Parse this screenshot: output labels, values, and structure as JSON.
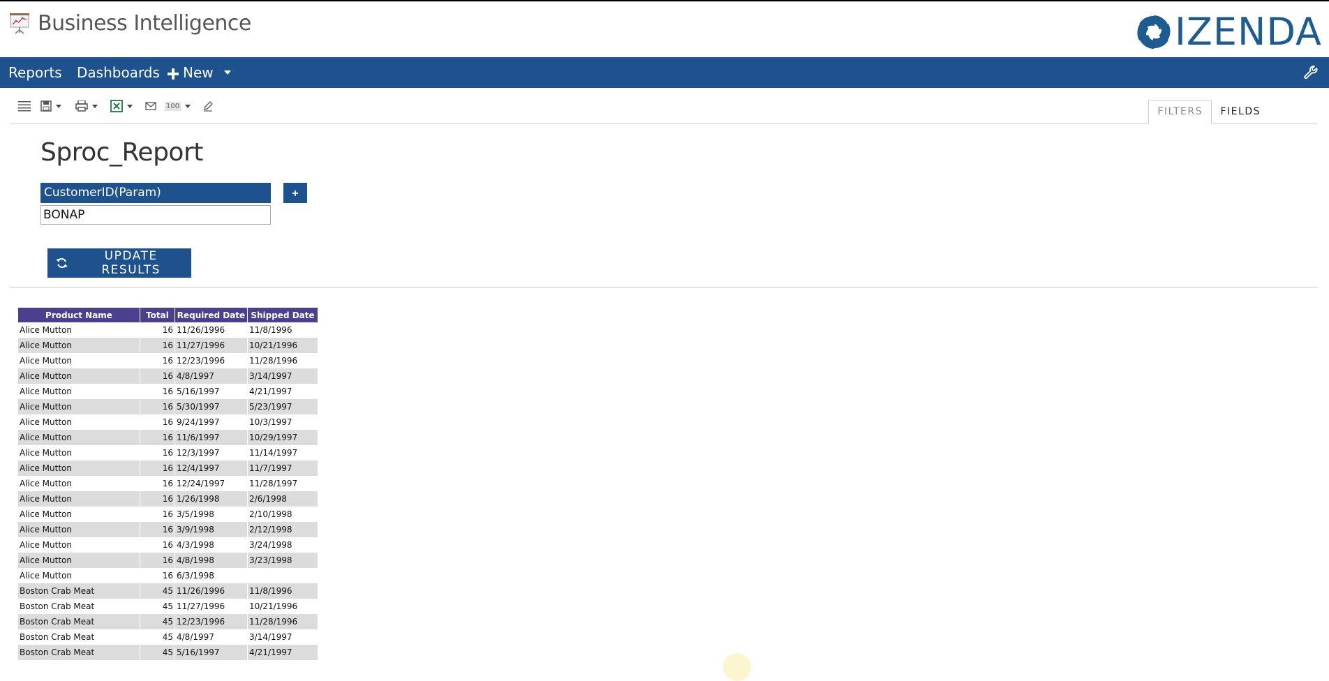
{
  "app": {
    "title": "Business Intelligence",
    "brand": "IZENDA"
  },
  "nav": {
    "reports": "Reports",
    "dashboards": "Dashboards",
    "new": "New"
  },
  "toolbar": {
    "zoom_value": "100"
  },
  "tabs": {
    "filters": "FILTERS",
    "fields": "FIELDS"
  },
  "report": {
    "title": "Sproc_Report"
  },
  "filter": {
    "label": "CustomerID(Param)",
    "value": "BONAP",
    "add_label": "+"
  },
  "update_button": {
    "label": "UPDATE RESULTS"
  },
  "table": {
    "columns": [
      "Product Name",
      "Total",
      "Required Date",
      "Shipped Date"
    ],
    "rows": [
      [
        "Alice Mutton",
        "16",
        "11/26/1996",
        "11/8/1996"
      ],
      [
        "Alice Mutton",
        "16",
        "11/27/1996",
        "10/21/1996"
      ],
      [
        "Alice Mutton",
        "16",
        "12/23/1996",
        "11/28/1996"
      ],
      [
        "Alice Mutton",
        "16",
        "4/8/1997",
        "3/14/1997"
      ],
      [
        "Alice Mutton",
        "16",
        "5/16/1997",
        "4/21/1997"
      ],
      [
        "Alice Mutton",
        "16",
        "5/30/1997",
        "5/23/1997"
      ],
      [
        "Alice Mutton",
        "16",
        "9/24/1997",
        "10/3/1997"
      ],
      [
        "Alice Mutton",
        "16",
        "11/6/1997",
        "10/29/1997"
      ],
      [
        "Alice Mutton",
        "16",
        "12/3/1997",
        "11/14/1997"
      ],
      [
        "Alice Mutton",
        "16",
        "12/4/1997",
        "11/7/1997"
      ],
      [
        "Alice Mutton",
        "16",
        "12/24/1997",
        "11/28/1997"
      ],
      [
        "Alice Mutton",
        "16",
        "1/26/1998",
        "2/6/1998"
      ],
      [
        "Alice Mutton",
        "16",
        "3/5/1998",
        "2/10/1998"
      ],
      [
        "Alice Mutton",
        "16",
        "3/9/1998",
        "2/12/1998"
      ],
      [
        "Alice Mutton",
        "16",
        "4/3/1998",
        "3/24/1998"
      ],
      [
        "Alice Mutton",
        "16",
        "4/8/1998",
        "3/23/1998"
      ],
      [
        "Alice Mutton",
        "16",
        "6/3/1998",
        ""
      ],
      [
        "Boston Crab Meat",
        "45",
        "11/26/1996",
        "11/8/1996"
      ],
      [
        "Boston Crab Meat",
        "45",
        "11/27/1996",
        "10/21/1996"
      ],
      [
        "Boston Crab Meat",
        "45",
        "12/23/1996",
        "11/28/1996"
      ],
      [
        "Boston Crab Meat",
        "45",
        "4/8/1997",
        "3/14/1997"
      ],
      [
        "Boston Crab Meat",
        "45",
        "5/16/1997",
        "4/21/1997"
      ]
    ]
  },
  "colors": {
    "primary": "#1e528e",
    "table_header": "#4b3f8f",
    "row_alt": "#dcdcdc",
    "brand": "#1d5b93"
  }
}
